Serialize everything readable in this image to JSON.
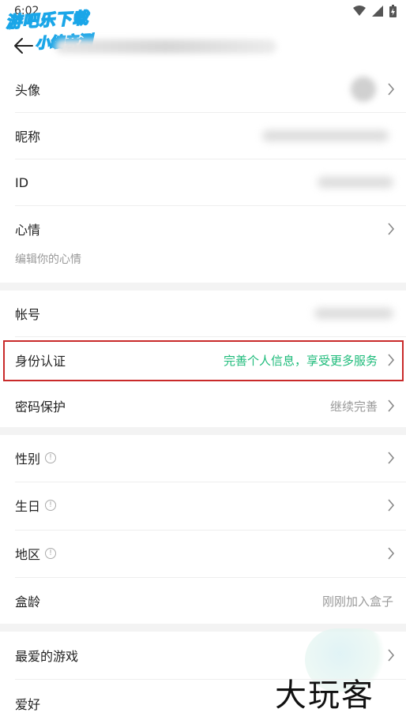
{
  "status": {
    "time": "6:02"
  },
  "watermark": {
    "line1": "游吧乐下载",
    "line2": "小编亲测"
  },
  "brand": {
    "text": "大玩客"
  },
  "rows": {
    "avatar": {
      "label": "头像"
    },
    "nickname": {
      "label": "昵称"
    },
    "id": {
      "label": "ID"
    },
    "mood": {
      "label": "心情",
      "placeholder": "编辑你的心情"
    },
    "account": {
      "label": "帐号"
    },
    "identity": {
      "label": "身份认证",
      "value": "完善个人信息，享受更多服务"
    },
    "password": {
      "label": "密码保护",
      "value": "继续完善"
    },
    "gender": {
      "label": "性别"
    },
    "birthday": {
      "label": "生日"
    },
    "region": {
      "label": "地区"
    },
    "box_age": {
      "label": "盒龄",
      "value": "刚刚加入盒子"
    },
    "fav_games": {
      "label": "最爱的游戏"
    },
    "hobby": {
      "label": "爱好"
    }
  },
  "colors": {
    "accent": "#1dbb7a",
    "highlight": "#c92a2a"
  }
}
